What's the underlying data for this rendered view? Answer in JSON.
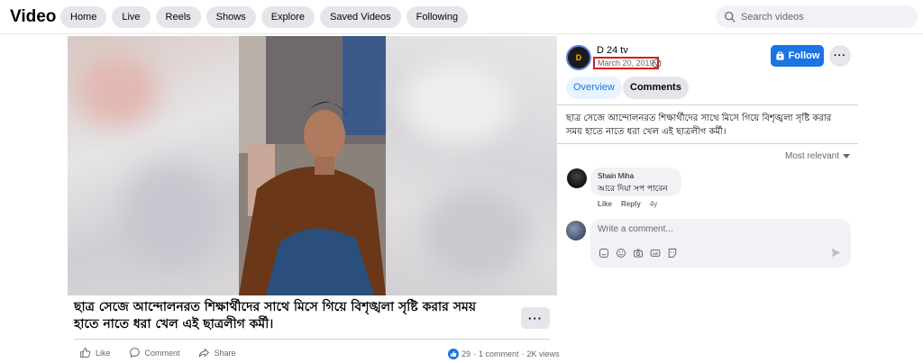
{
  "header": {
    "title": "Video",
    "nav": [
      "Home",
      "Live",
      "Reels",
      "Shows",
      "Explore",
      "Saved Videos",
      "Following"
    ],
    "search_placeholder": "Search videos"
  },
  "video": {
    "caption": "ছাত্র সেজে আন্দোলনরত শিক্ষার্থীদের সাথে মিসে গিয়ে বিশৃঙ্খলা সৃষ্টি করার সময় হাতে নাতে ধরা খেল এই ছাত্রলীগ কর্মী।",
    "more": "···",
    "actions": [
      "Like",
      "Comment",
      "Share"
    ],
    "reactions": "29",
    "comments": "1 comment",
    "views": "2K views",
    "sep": "·"
  },
  "panel": {
    "page_name": "D 24 tv",
    "logo_text": "D",
    "date": "March 20, 2019",
    "follow": "Follow",
    "more": "···",
    "tabs": [
      "Overview",
      "Comments"
    ],
    "description": "ছাত্র সেজে আন্দোলনরত শিক্ষার্থীদের সাথে মিসে গিয়ে বিশৃঙ্খলা সৃষ্টি করার সময় হাতে নাতে ধরা খেল এই ছাত্রলীগ কর্মী।",
    "sort_label": "Most relevant",
    "comment": {
      "author": "Shain Miha",
      "text": "আরে দিয়া সপ পাবেন",
      "like": "Like",
      "reply": "Reply",
      "age": "4y"
    },
    "compose_placeholder": "Write a comment..."
  },
  "colors": {
    "accent": "#1b74e4",
    "highlight": "#e0141a"
  }
}
